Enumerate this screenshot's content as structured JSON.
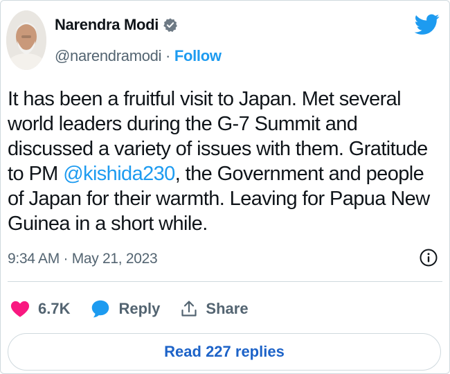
{
  "author": {
    "name": "Narendra Modi",
    "handle": "@narendramodi",
    "separator": "·",
    "follow_label": "Follow"
  },
  "tweet": {
    "text_before_mention": "It has been a fruitful visit to Japan. Met several world leaders during the G-7 Summit and discussed a variety of issues with them. Gratitude to PM ",
    "mention": "@kishida230",
    "text_after_mention": ", the Government and people of Japan for their warmth. Leaving for Papua New Guinea in a short while.",
    "timestamp": "9:34 AM · May 21, 2023"
  },
  "actions": {
    "like_count": "6.7K",
    "reply_label": "Reply",
    "share_label": "Share"
  },
  "read_replies_label": "Read 227 replies",
  "colors": {
    "accent": "#1d9bf0",
    "like": "#f91880",
    "reply": "#1d9bf0",
    "text": "#0f1419",
    "muted": "#536471",
    "border": "#cfd9de"
  },
  "icons": {
    "brand": "twitter-bird-icon",
    "verified": "verified-badge-icon",
    "info": "info-icon",
    "like": "heart-icon",
    "reply": "speech-bubble-icon",
    "share": "share-upload-icon"
  }
}
